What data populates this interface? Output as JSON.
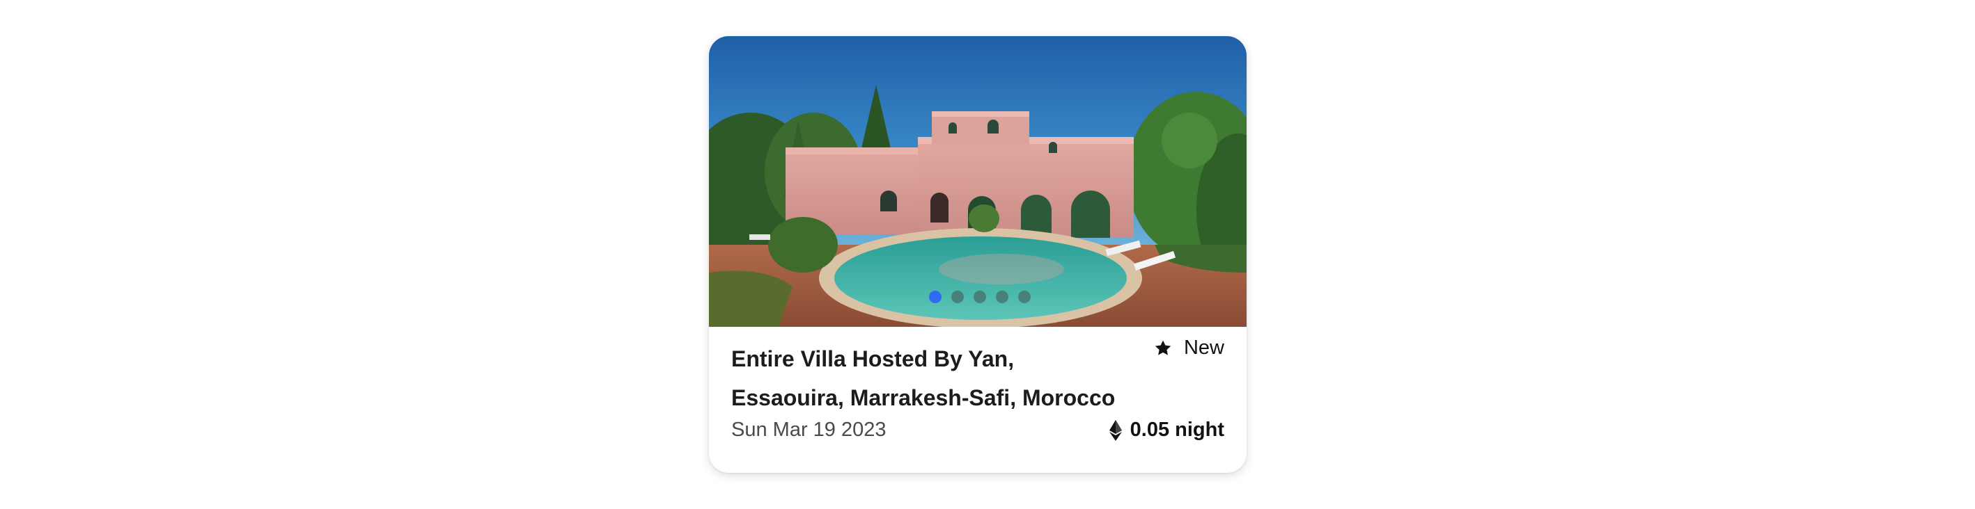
{
  "listing": {
    "title": "Entire Villa Hosted By Yan, Essaouira, Marrakesh-Safi, Morocco",
    "rating_label": "New",
    "rating_icon": "star-icon",
    "date": "Sun Mar 19 2023",
    "price": "0.05 night",
    "currency_icon": "ethereum-icon",
    "carousel": {
      "total_images": 5,
      "active_index": 0,
      "active_dot_color": "#2f6bf2"
    }
  }
}
